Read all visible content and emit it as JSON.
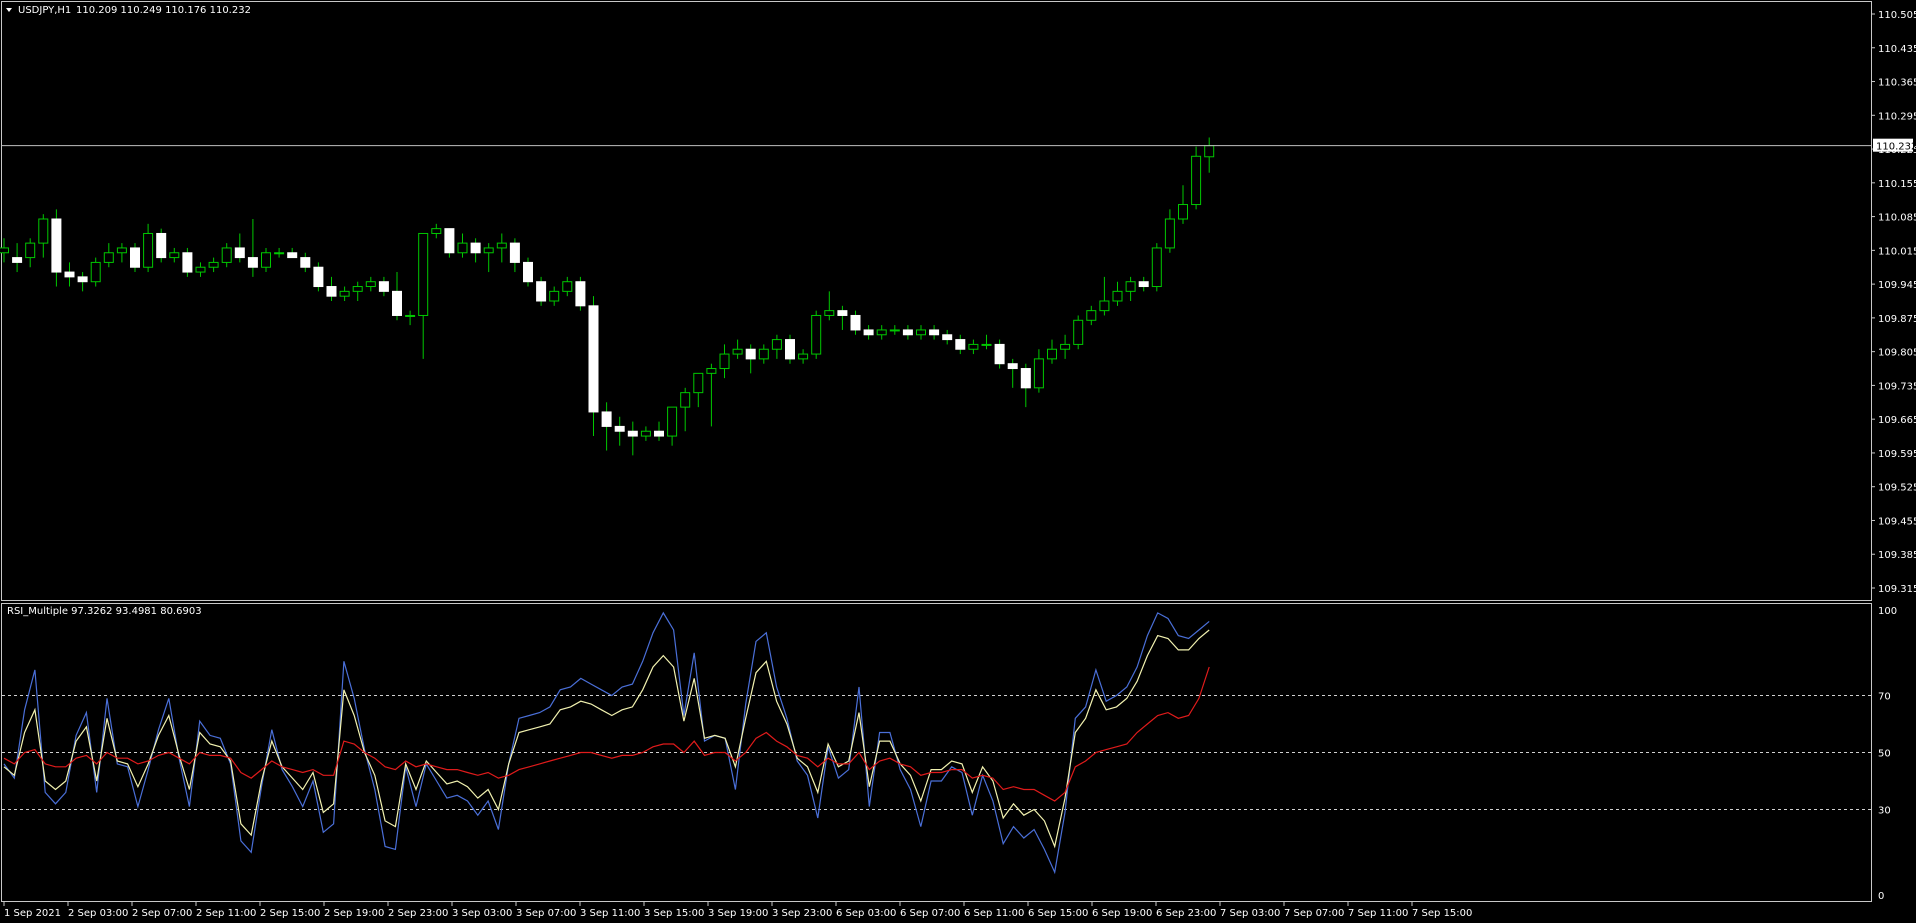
{
  "colors": {
    "background": "#000000",
    "frame": "#c8c8c8",
    "candle_outline": "#00c800",
    "candle_fill": "#ffffff",
    "bid_line": "#c0c0c0",
    "rsi_fast": "#4a6fd8",
    "rsi_mid": "#f2f2b0",
    "rsi_slow": "#e01b1b",
    "level_line": "#d0d0d0"
  },
  "header": {
    "menu_icon": "triangle-down-icon",
    "symbol_timeframe": "USDJPY,H1",
    "ohlc": "110.209 110.249 110.176 110.232"
  },
  "price_axis": {
    "ticks": [
      "110.505",
      "110.435",
      "110.365",
      "110.295",
      "110.225",
      "110.155",
      "110.085",
      "110.015",
      "109.945",
      "109.875",
      "109.805",
      "109.735",
      "109.665",
      "109.595",
      "109.525",
      "109.455",
      "109.385",
      "109.315"
    ],
    "current_price": "110.232"
  },
  "indicator": {
    "label": "RSI_Multiple 97.3262 93.4981 80.6903",
    "levels": [
      "100",
      "70",
      "50",
      "30",
      "0"
    ]
  },
  "time_axis": {
    "labels": [
      "1 Sep 2021",
      "2 Sep 03:00",
      "2 Sep 07:00",
      "2 Sep 11:00",
      "2 Sep 15:00",
      "2 Sep 19:00",
      "2 Sep 23:00",
      "3 Sep 03:00",
      "3 Sep 07:00",
      "3 Sep 11:00",
      "3 Sep 15:00",
      "3 Sep 19:00",
      "3 Sep 23:00",
      "6 Sep 03:00",
      "6 Sep 07:00",
      "6 Sep 11:00",
      "6 Sep 15:00",
      "6 Sep 19:00",
      "6 Sep 23:00",
      "7 Sep 03:00",
      "7 Sep 07:00",
      "7 Sep 11:00",
      "7 Sep 15:00"
    ]
  },
  "chart_data": [
    {
      "type": "candlestick",
      "title": "USDJPY,H1",
      "ylim": [
        109.315,
        110.505
      ],
      "x_labels": [
        "1 Sep 2021",
        "2 Sep 03:00",
        "2 Sep 07:00",
        "2 Sep 11:00",
        "2 Sep 15:00",
        "2 Sep 19:00",
        "2 Sep 23:00",
        "3 Sep 03:00",
        "3 Sep 07:00",
        "3 Sep 11:00",
        "3 Sep 15:00",
        "3 Sep 19:00",
        "3 Sep 23:00",
        "6 Sep 03:00",
        "6 Sep 07:00",
        "6 Sep 11:00",
        "6 Sep 15:00",
        "6 Sep 19:00",
        "6 Sep 23:00",
        "7 Sep 03:00",
        "7 Sep 07:00",
        "7 Sep 11:00",
        "7 Sep 15:00"
      ],
      "ohlc": [
        [
          110.01,
          110.04,
          109.99,
          110.02
        ],
        [
          110.0,
          110.03,
          109.97,
          109.99
        ],
        [
          110.0,
          110.04,
          109.98,
          110.03
        ],
        [
          110.03,
          110.09,
          110.0,
          110.08
        ],
        [
          110.08,
          110.1,
          109.94,
          109.97
        ],
        [
          109.97,
          109.99,
          109.94,
          109.96
        ],
        [
          109.96,
          109.97,
          109.93,
          109.95
        ],
        [
          109.95,
          110.0,
          109.94,
          109.99
        ],
        [
          109.99,
          110.03,
          109.98,
          110.01
        ],
        [
          110.01,
          110.03,
          109.99,
          110.02
        ],
        [
          110.02,
          110.03,
          109.97,
          109.98
        ],
        [
          109.98,
          110.07,
          109.97,
          110.05
        ],
        [
          110.05,
          110.06,
          109.99,
          110.0
        ],
        [
          110.0,
          110.02,
          109.99,
          110.01
        ],
        [
          110.01,
          110.02,
          109.96,
          109.97
        ],
        [
          109.97,
          109.99,
          109.96,
          109.98
        ],
        [
          109.98,
          110.0,
          109.97,
          109.99
        ],
        [
          109.99,
          110.03,
          109.98,
          110.02
        ],
        [
          110.02,
          110.05,
          109.99,
          110.0
        ],
        [
          110.0,
          110.08,
          109.96,
          109.98
        ],
        [
          109.98,
          110.02,
          109.97,
          110.01
        ],
        [
          110.01,
          110.02,
          110.0,
          110.01
        ],
        [
          110.01,
          110.02,
          110.0,
          110.0
        ],
        [
          110.0,
          110.01,
          109.97,
          109.98
        ],
        [
          109.98,
          109.99,
          109.93,
          109.94
        ],
        [
          109.94,
          109.96,
          109.91,
          109.92
        ],
        [
          109.92,
          109.94,
          109.91,
          109.93
        ],
        [
          109.93,
          109.95,
          109.91,
          109.94
        ],
        [
          109.94,
          109.96,
          109.93,
          109.95
        ],
        [
          109.95,
          109.96,
          109.92,
          109.93
        ],
        [
          109.93,
          109.97,
          109.87,
          109.88
        ],
        [
          109.88,
          109.89,
          109.86,
          109.88
        ],
        [
          109.88,
          110.05,
          109.79,
          110.05
        ],
        [
          110.05,
          110.07,
          110.04,
          110.06
        ],
        [
          110.06,
          110.06,
          110.0,
          110.01
        ],
        [
          110.01,
          110.05,
          110.0,
          110.03
        ],
        [
          110.03,
          110.04,
          109.99,
          110.01
        ],
        [
          110.01,
          110.03,
          109.97,
          110.02
        ],
        [
          110.02,
          110.05,
          109.99,
          110.03
        ],
        [
          110.03,
          110.04,
          109.97,
          109.99
        ],
        [
          109.99,
          110.0,
          109.94,
          109.95
        ],
        [
          109.95,
          109.96,
          109.9,
          109.91
        ],
        [
          109.91,
          109.94,
          109.9,
          109.93
        ],
        [
          109.93,
          109.96,
          109.92,
          109.95
        ],
        [
          109.95,
          109.96,
          109.89,
          109.9
        ],
        [
          109.9,
          109.92,
          109.63,
          109.68
        ],
        [
          109.68,
          109.7,
          109.6,
          109.65
        ],
        [
          109.65,
          109.67,
          109.61,
          109.64
        ],
        [
          109.64,
          109.66,
          109.59,
          109.63
        ],
        [
          109.63,
          109.65,
          109.62,
          109.64
        ],
        [
          109.64,
          109.66,
          109.62,
          109.63
        ],
        [
          109.63,
          109.68,
          109.61,
          109.69
        ],
        [
          109.69,
          109.73,
          109.64,
          109.72
        ],
        [
          109.72,
          109.76,
          109.69,
          109.76
        ],
        [
          109.76,
          109.78,
          109.65,
          109.77
        ],
        [
          109.77,
          109.82,
          109.75,
          109.8
        ],
        [
          109.8,
          109.83,
          109.79,
          109.81
        ],
        [
          109.81,
          109.82,
          109.76,
          109.79
        ],
        [
          109.79,
          109.82,
          109.78,
          109.81
        ],
        [
          109.81,
          109.84,
          109.79,
          109.83
        ],
        [
          109.83,
          109.84,
          109.78,
          109.79
        ],
        [
          109.79,
          109.81,
          109.78,
          109.8
        ],
        [
          109.8,
          109.89,
          109.79,
          109.88
        ],
        [
          109.88,
          109.93,
          109.87,
          109.89
        ],
        [
          109.89,
          109.9,
          109.85,
          109.88
        ],
        [
          109.88,
          109.89,
          109.84,
          109.85
        ],
        [
          109.85,
          109.86,
          109.83,
          109.84
        ],
        [
          109.84,
          109.86,
          109.83,
          109.85
        ],
        [
          109.85,
          109.86,
          109.84,
          109.85
        ],
        [
          109.85,
          109.86,
          109.83,
          109.84
        ],
        [
          109.84,
          109.86,
          109.83,
          109.85
        ],
        [
          109.85,
          109.86,
          109.83,
          109.84
        ],
        [
          109.84,
          109.85,
          109.82,
          109.83
        ],
        [
          109.83,
          109.84,
          109.8,
          109.81
        ],
        [
          109.81,
          109.83,
          109.8,
          109.82
        ],
        [
          109.82,
          109.84,
          109.81,
          109.82
        ],
        [
          109.82,
          109.83,
          109.77,
          109.78
        ],
        [
          109.78,
          109.79,
          109.73,
          109.77
        ],
        [
          109.77,
          109.78,
          109.69,
          109.73
        ],
        [
          109.73,
          109.81,
          109.72,
          109.79
        ],
        [
          109.79,
          109.83,
          109.78,
          109.81
        ],
        [
          109.81,
          109.84,
          109.79,
          109.82
        ],
        [
          109.82,
          109.88,
          109.81,
          109.87
        ],
        [
          109.87,
          109.9,
          109.86,
          109.89
        ],
        [
          109.89,
          109.96,
          109.88,
          109.91
        ],
        [
          109.91,
          109.95,
          109.9,
          109.93
        ],
        [
          109.93,
          109.96,
          109.91,
          109.95
        ],
        [
          109.95,
          109.96,
          109.93,
          109.94
        ],
        [
          109.94,
          110.03,
          109.93,
          110.02
        ],
        [
          110.02,
          110.1,
          110.01,
          110.08
        ],
        [
          110.08,
          110.15,
          110.07,
          110.11
        ],
        [
          110.11,
          110.23,
          110.1,
          110.21
        ],
        [
          110.209,
          110.249,
          110.176,
          110.232
        ]
      ]
    },
    {
      "type": "line",
      "title": "RSI_Multiple 97.3262 93.4981 80.6903",
      "ylim": [
        0,
        100
      ],
      "levels": [
        70,
        50,
        30
      ],
      "series": [
        {
          "values": [
            46,
            41,
            65,
            79,
            36,
            32,
            36,
            56,
            64,
            36,
            69,
            46,
            45,
            31,
            44,
            58,
            69,
            48,
            31,
            61,
            56,
            55,
            46,
            19,
            15,
            38,
            58,
            44,
            38,
            31,
            40,
            22,
            25,
            82,
            69,
            51,
            37,
            17,
            16,
            45,
            31,
            46,
            40,
            34,
            35,
            33,
            28,
            33,
            23,
            46,
            62,
            63,
            64,
            66,
            72,
            73,
            76,
            74,
            72,
            70,
            73,
            74,
            82,
            92,
            99,
            93,
            63,
            85,
            54,
            56,
            55,
            37,
            67,
            89,
            92,
            73,
            62,
            47,
            42,
            27,
            52,
            41,
            44,
            73,
            31,
            57,
            57,
            44,
            37,
            24,
            40,
            40,
            45,
            43,
            28,
            42,
            33,
            18,
            24,
            20,
            23,
            16,
            8,
            29,
            62,
            66,
            79,
            68,
            70,
            73,
            80,
            91,
            99,
            97,
            91,
            90,
            93,
            96
          ]
        },
        {
          "values": [
            45,
            42,
            57,
            65,
            40,
            37,
            40,
            54,
            59,
            40,
            62,
            47,
            46,
            38,
            46,
            56,
            63,
            49,
            37,
            57,
            53,
            52,
            47,
            25,
            21,
            40,
            54,
            45,
            41,
            37,
            43,
            29,
            32,
            72,
            63,
            50,
            42,
            26,
            24,
            46,
            37,
            47,
            43,
            39,
            40,
            38,
            34,
            37,
            30,
            46,
            57,
            58,
            59,
            60,
            65,
            66,
            68,
            67,
            65,
            63,
            65,
            66,
            72,
            80,
            84,
            80,
            61,
            76,
            55,
            56,
            55,
            45,
            62,
            78,
            82,
            68,
            60,
            48,
            45,
            36,
            53,
            45,
            47,
            64,
            38,
            54,
            54,
            46,
            42,
            33,
            44,
            44,
            47,
            46,
            36,
            45,
            40,
            27,
            32,
            28,
            30,
            26,
            17,
            34,
            57,
            62,
            72,
            65,
            66,
            69,
            75,
            84,
            91,
            90,
            86,
            86,
            90,
            93
          ]
        },
        {
          "values": [
            48,
            46,
            50,
            51,
            46,
            45,
            45,
            48,
            49,
            46,
            50,
            48,
            48,
            46,
            47,
            49,
            50,
            48,
            46,
            50,
            49,
            49,
            48,
            43,
            41,
            44,
            47,
            45,
            44,
            43,
            44,
            42,
            42,
            54,
            53,
            50,
            48,
            45,
            44,
            47,
            45,
            46,
            45,
            44,
            44,
            43,
            42,
            43,
            41,
            42,
            44,
            45,
            46,
            47,
            48,
            49,
            50,
            50,
            49,
            48,
            49,
            49,
            50,
            52,
            53,
            53,
            50,
            54,
            49,
            50,
            50,
            47,
            50,
            55,
            57,
            54,
            52,
            49,
            48,
            45,
            48,
            46,
            46,
            50,
            44,
            47,
            48,
            46,
            45,
            42,
            43,
            43,
            44,
            44,
            41,
            42,
            41,
            37,
            38,
            37,
            37,
            35,
            33,
            36,
            45,
            47,
            50,
            51,
            52,
            53,
            57,
            60,
            63,
            64,
            62,
            63,
            69,
            80
          ]
        }
      ]
    }
  ]
}
